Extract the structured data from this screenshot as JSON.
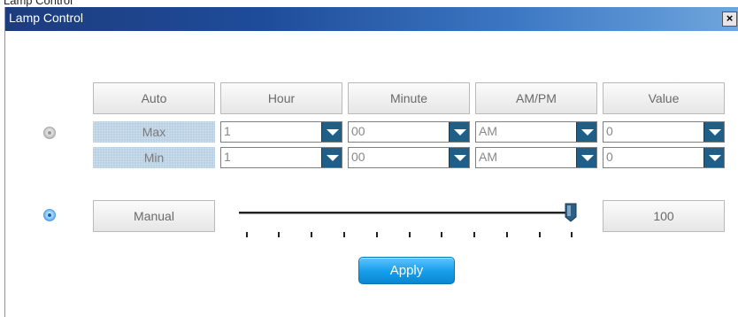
{
  "window": {
    "outer_caption": "Lamp Control",
    "title": "Lamp Control",
    "close_label": "×"
  },
  "headers": {
    "auto": "Auto",
    "hour": "Hour",
    "minute": "Minute",
    "ampm": "AM/PM",
    "value": "Value"
  },
  "rows": [
    {
      "label": "Max",
      "hour": "1",
      "minute": "00",
      "ampm": "AM",
      "value": "0"
    },
    {
      "label": "Min",
      "hour": "1",
      "minute": "00",
      "ampm": "AM",
      "value": "0"
    }
  ],
  "mode": {
    "auto_selected": false,
    "manual_selected": true
  },
  "manual": {
    "label": "Manual",
    "slider_value": 100,
    "slider_max": 100,
    "value_display": "100"
  },
  "apply_label": "Apply",
  "colors": {
    "title_gradient_start": "#1d3c7d",
    "title_gradient_end": "#6fa6dd",
    "dropdown_arrow": "#1f5f86",
    "row_label_bg": "#b9cfe4",
    "apply_button": "#1aa0ec"
  },
  "icons": {
    "close": "close-icon",
    "dropdown": "chevron-down-icon",
    "radio": "radio-icon"
  }
}
